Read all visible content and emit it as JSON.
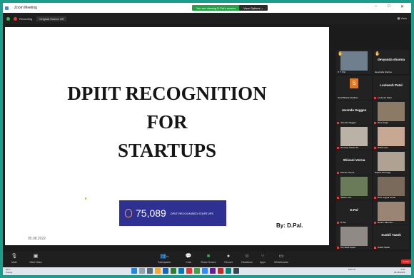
{
  "window": {
    "title": "Zoom Meeting"
  },
  "share_banner": {
    "label": "You are viewing D.Pal's screen",
    "view_options": "View Options"
  },
  "topbar": {
    "recording": "Recording",
    "original_sound": "Original Sound: Off",
    "view": "View"
  },
  "slide": {
    "title_lines": [
      "DPIIT RECOGNITION",
      "FOR",
      "STARTUPS"
    ],
    "stat_number": "75,089",
    "stat_label": "DPIIT RECOGNISED STARTUPS",
    "date": "05.08.2022",
    "author": "By: D.Pal."
  },
  "participants": [
    {
      "name": "P. T. Pai",
      "type": "photo",
      "hand": true,
      "muted": false
    },
    {
      "name": "devyanda sharma",
      "header": "devyanda sharma",
      "type": "name",
      "hand": true,
      "muted": false
    },
    {
      "name": "Soolf Bharat Vardhan",
      "type": "avatar",
      "initial": "S",
      "muted": false
    },
    {
      "name": "Lovleesh Patel",
      "header": "Lovleesh Patel",
      "type": "name",
      "muted": true
    },
    {
      "name": "Jarenda Saggen",
      "header": "Jarenda Saggen",
      "type": "name",
      "muted": true
    },
    {
      "name": "Ram Singh",
      "type": "photo",
      "muted": true
    },
    {
      "name": "Ghuvaly Shukla Dr.",
      "type": "photo",
      "muted": true
    },
    {
      "name": "Nikita Oyal",
      "type": "photo",
      "muted": true
    },
    {
      "name": "Shivani Verma",
      "header": "Shivani Verma",
      "type": "name",
      "muted": true
    },
    {
      "name": "Rajesh Dhondge",
      "type": "photo",
      "muted": false
    },
    {
      "name": "Jaskar Jab...",
      "type": "photo",
      "muted": true
    },
    {
      "name": "Ravi Jogiyal surain",
      "type": "photo",
      "muted": true
    },
    {
      "name": "D.Pal",
      "header": "D.Pal",
      "type": "name",
      "muted": true
    },
    {
      "name": "Rohini Jalan Ex...",
      "type": "photo",
      "muted": true
    },
    {
      "name": "Om Boldi Kapor",
      "type": "photo",
      "muted": true
    },
    {
      "name": "Sushil Taank",
      "header": "Sushil Taank",
      "type": "name",
      "muted": true
    }
  ],
  "toolbar": {
    "mute": "Mute",
    "start_video": "Start Video",
    "participants": "Participants",
    "participants_count": "13",
    "chat": "Chat",
    "share_screen": "Share Screen",
    "record": "Record",
    "reactions": "Reactions",
    "apps": "Apps",
    "whiteboards": "Whiteboards",
    "leave": "Leave"
  },
  "taskbar": {
    "weather_temp": "30°C",
    "weather_desc": "Cloudy",
    "tray": "ENG IN",
    "time": "3:50",
    "date": "05-08-2022"
  },
  "colors": {
    "accent_green": "#22a444",
    "slide_box": "#2e3192",
    "leave": "#e02828",
    "avatar": "#e2761f"
  }
}
